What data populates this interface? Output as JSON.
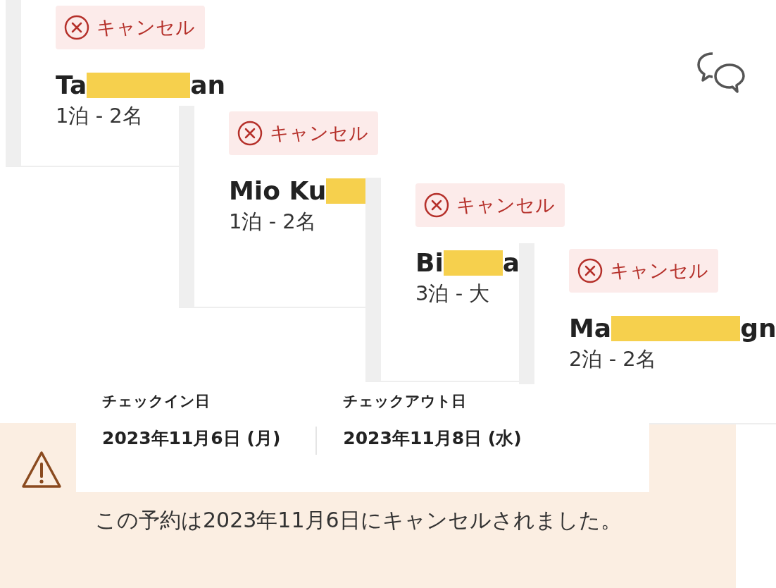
{
  "cards": [
    {
      "status": "キャンセル",
      "name_start": "Ta",
      "name_end": "an",
      "stay": "1泊 - 2名"
    },
    {
      "status": "キャンセル",
      "name_start": "Mio Ku",
      "stay": "1泊 - 2名"
    },
    {
      "status": "キャンセル",
      "name_start": "Bi",
      "name_end": "a",
      "stay": "3泊 - 大"
    },
    {
      "status": "キャンセル",
      "name_start": "Ma",
      "name_end": "gn",
      "stay": "2泊 - 2名"
    }
  ],
  "dates": [
    {
      "label": "チェックイン日",
      "value": "2023年11月6日 (月)"
    },
    {
      "label": "チェックアウト日",
      "value": "2023年11月8日 (水)"
    }
  ],
  "notice": "この予約は2023年11月6日にキャンセルされました。"
}
